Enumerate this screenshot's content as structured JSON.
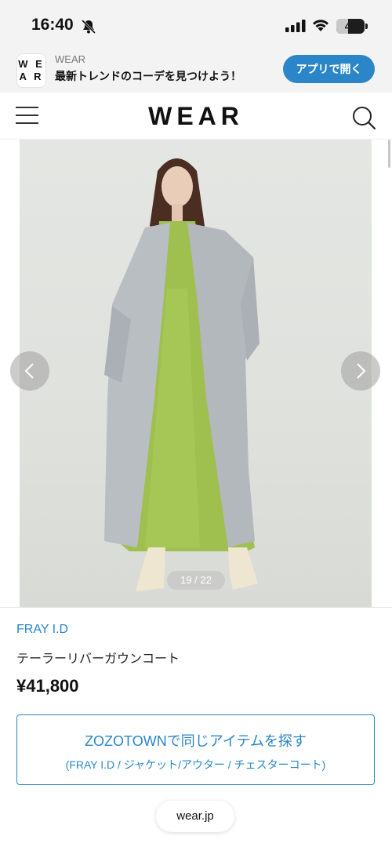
{
  "status_bar": {
    "time": "16:40",
    "battery_level": "43",
    "icons": [
      "bell-slash-icon",
      "signal-icon",
      "wifi-icon",
      "battery-icon"
    ]
  },
  "app_banner": {
    "logo_text": "WE AR",
    "app_name": "WEAR",
    "tagline": "最新トレンドのコーデを見つけよう！",
    "open_button": "アプリで開く"
  },
  "header": {
    "logo": "WEAR",
    "icons": [
      "hamburger-menu-icon",
      "search-icon"
    ]
  },
  "gallery": {
    "counter": "19 / 22",
    "current": 19,
    "total": 22,
    "icons": [
      "chevron-left-icon",
      "chevron-right-icon"
    ]
  },
  "product": {
    "brand": "FRAY I.D",
    "name": "テーラーリバーガウンコート",
    "price": "¥41,800",
    "zozo_button": {
      "main": "ZOZOTOWNで同じアイテムを探す",
      "sub": "(FRAY I.D / ジャケット/アウター / チェスターコート)"
    }
  },
  "browser": {
    "url": "wear.jp"
  },
  "colors": {
    "accent": "#2a86c9",
    "coat": "#b9bec3",
    "dress": "#9fbf4e",
    "background": "#e2e4e1"
  }
}
